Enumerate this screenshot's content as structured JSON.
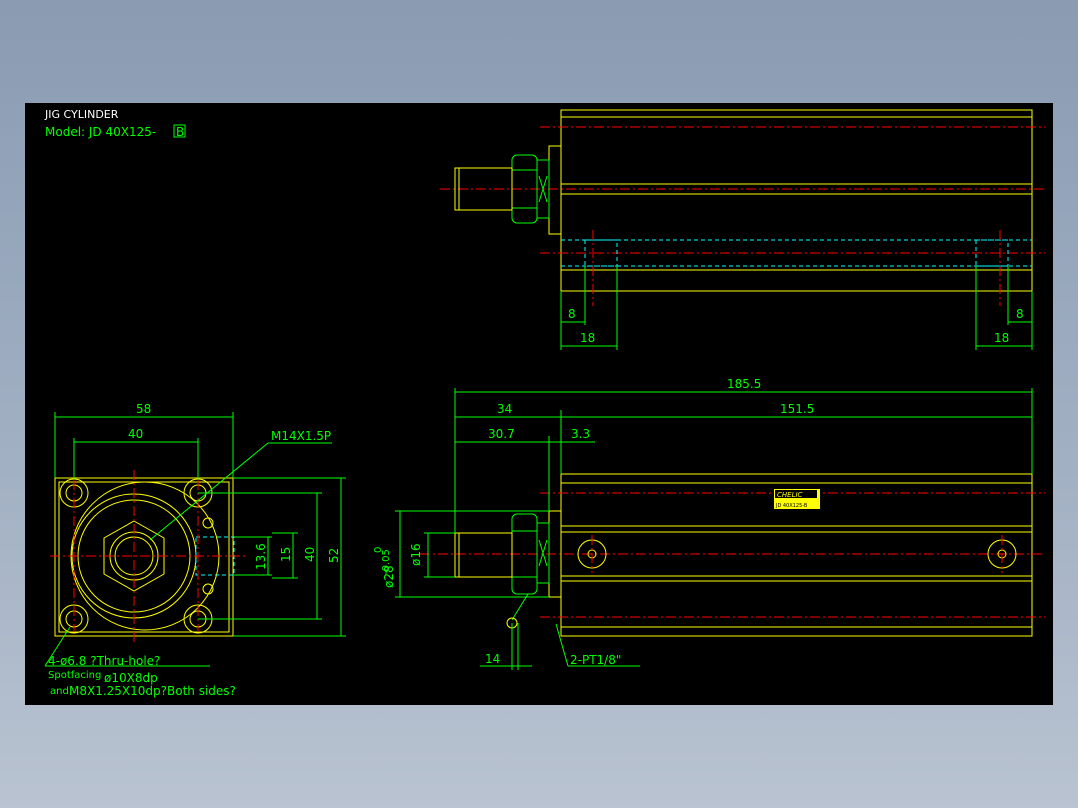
{
  "title": "JIG CYLINDER",
  "model_prefix": "Model: JD 40X125-",
  "model_suffix": "B",
  "colors": {
    "outline": "#ffff00",
    "dimension": "#00ff00",
    "centerline": "#ff0000",
    "hidden": "#00ffff",
    "text": "#ffffff"
  },
  "dims": {
    "top_8_left": "8",
    "top_18_left": "18",
    "top_8_right": "8",
    "top_18_right": "18",
    "total_length": "185.5",
    "rod_length": "34",
    "body_length": "151.5",
    "rod_extension": "30.7",
    "flange": "3.3",
    "dia_28": "ø28",
    "dia_28_tol_upper": "0",
    "dia_28_tol_lower": "-0.05",
    "dia_16": "ø16",
    "d14": "14",
    "port_note": "2-PT1/8\"",
    "end_width": "58",
    "end_bolt_spacing": "40",
    "thread": "M14X1.5P",
    "h_13_6": "13.6",
    "h_15": "15",
    "h_40": "40",
    "h_52": "52"
  },
  "notes": {
    "holes": "4-ø6.8  ?Thru-hole?",
    "spotfacing_label": "Spotfacing",
    "spotfacing_value": "ø10X8dp",
    "and_label": "and",
    "thread_note": "M8X1.25X10dp?Both sides?"
  },
  "brand_label": "CHELIC",
  "brand_sub": "JD 40X125-B"
}
